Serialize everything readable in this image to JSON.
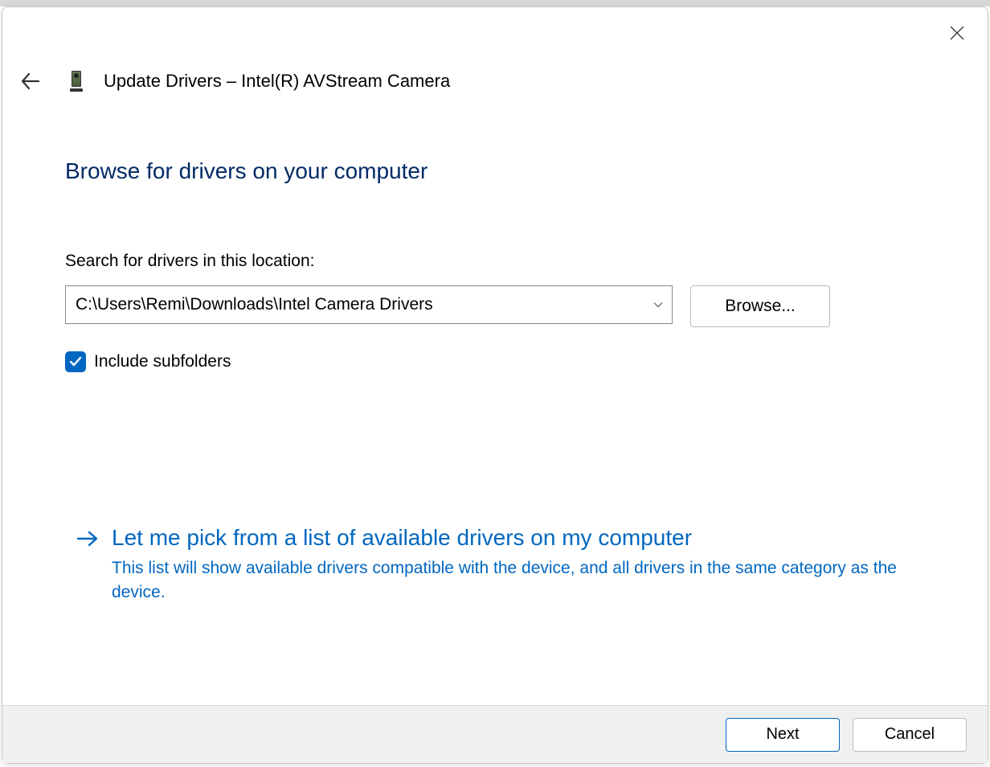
{
  "header": {
    "title": "Update Drivers – Intel(R) AVStream Camera"
  },
  "section": {
    "heading": "Browse for drivers on your computer",
    "search_label": "Search for drivers in this location:",
    "path_value": "C:\\Users\\Remi\\Downloads\\Intel Camera Drivers",
    "browse_label": "Browse...",
    "include_subfolders_label": "Include subfolders",
    "include_subfolders_checked": true
  },
  "option": {
    "title": "Let me pick from a list of available drivers on my computer",
    "description": "This list will show available drivers compatible with the device, and all drivers in the same category as the device."
  },
  "footer": {
    "next_label": "Next",
    "cancel_label": "Cancel"
  }
}
